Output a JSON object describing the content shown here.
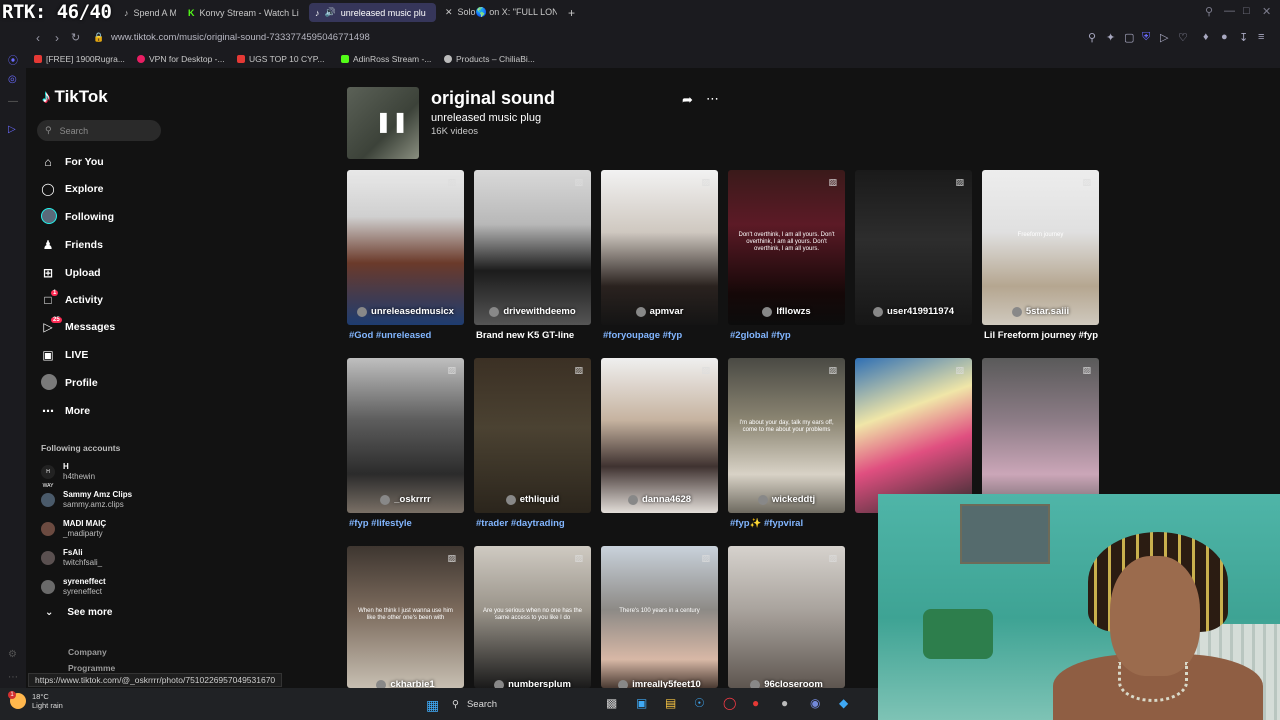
{
  "overlay": {
    "rtk": "RTK: 46/40"
  },
  "tabs": [
    {
      "label": "Spend A M",
      "active": false,
      "icon": "tiktok-icon"
    },
    {
      "label": "Konvy Stream - Watch Li",
      "active": false,
      "icon": "kick-icon"
    },
    {
      "label": "unreleased music plu",
      "active": true,
      "icon": "tiktok-icon"
    },
    {
      "label": "Solo🌎 on X: \"FULL LON",
      "active": false,
      "icon": "x-icon"
    }
  ],
  "address": {
    "url": "www.tiktok.com/music/original-sound-7333774595046771498"
  },
  "bookmarks": [
    {
      "label": "[FREE] 1900Rugra...",
      "color": "#e53935"
    },
    {
      "label": "VPN for Desktop -...",
      "color": "#e91e63"
    },
    {
      "label": "UGS TOP 10 CYP...",
      "color": "#e53935"
    },
    {
      "label": "AdinRoss Stream -...",
      "color": "#53fc18"
    },
    {
      "label": "Products – ChiliaBi...",
      "color": "#bbbbbb"
    }
  ],
  "brand": {
    "name": "TikTok"
  },
  "search": {
    "placeholder": "Search"
  },
  "nav": [
    {
      "label": "For You",
      "icon": "home-icon"
    },
    {
      "label": "Explore",
      "icon": "compass-icon"
    },
    {
      "label": "Following",
      "icon": "following-avatar"
    },
    {
      "label": "Friends",
      "icon": "friends-icon"
    },
    {
      "label": "Upload",
      "icon": "upload-icon"
    },
    {
      "label": "Activity",
      "icon": "activity-icon",
      "badge": "1"
    },
    {
      "label": "Messages",
      "icon": "messages-icon",
      "badge": "25"
    },
    {
      "label": "LIVE",
      "icon": "live-icon"
    },
    {
      "label": "Profile",
      "icon": "profile-avatar"
    },
    {
      "label": "More",
      "icon": "more-icon"
    }
  ],
  "following_accounts": {
    "title": "Following accounts",
    "items": [
      {
        "display": "H",
        "handle": "h4thewin"
      },
      {
        "display": "Sammy Amz Clips",
        "handle": "sammy.amz.clips"
      },
      {
        "display": "MADI MAIÇ",
        "handle": "_madiparty"
      },
      {
        "display": "FsAli",
        "handle": "twitchfsali_"
      },
      {
        "display": "syreneffect",
        "handle": "syreneffect"
      }
    ],
    "see_more": "See more"
  },
  "footer_links": {
    "company": "Company",
    "program": "Programme"
  },
  "sound": {
    "title": "original sound",
    "subtitle": "unreleased music plug",
    "video_count": "16K videos"
  },
  "videos": [
    {
      "user": "unreleasedmusicx",
      "caption": "#God #unreleased",
      "caption_type": "hash",
      "bg": "linear-gradient(180deg,#e8e8e8 0%,#d0d0d0 30%,#6b3a2a 60%,#1e3c70 100%)",
      "overlay": ""
    },
    {
      "user": "drivewithdeemo",
      "caption": "Brand new K5 GT-line",
      "caption_type": "plain",
      "bg": "linear-gradient(180deg,#d9d9d9 0%,#b8b8b8 35%,#1c1c1c 65%,#555 100%)",
      "overlay": ""
    },
    {
      "user": "apmvar",
      "caption": "#foryoupage #fyp",
      "caption_type": "hash",
      "bg": "linear-gradient(180deg,#f2f2f2 0%,#cfc8c0 40%,#2a221f 75%,#141414 100%)",
      "overlay": ""
    },
    {
      "user": "lfllowzs",
      "caption": "#2global #fyp",
      "caption_type": "hash",
      "bg": "linear-gradient(180deg,#3a1a1a 0%,#5c1a26 35%,#150808 80%,#0c0c0c 100%)",
      "overlay": "Don't overthink, I am all yours.\nDon't overthink, I am all yours.\nDon't overthink, I am all yours."
    },
    {
      "user": "user419911974",
      "caption": "",
      "caption_type": "plain",
      "bg": "linear-gradient(180deg,#1a1a1a 0%,#2d2d2d 45%,#161616 100%)",
      "overlay": ""
    },
    {
      "user": "5star.saiii",
      "caption": "Lil Freeform journey #fyp",
      "caption_type": "plain",
      "bg": "linear-gradient(180deg,#ededed 0%,#e0e0e0 40%,#b5a690 75%,#cfc9be 100%)",
      "overlay": "Freeform journey"
    },
    {
      "user": "_oskrrrr",
      "caption": "#fyp #lifestyle",
      "caption_type": "hash",
      "bg": "linear-gradient(180deg,#bfbfbf 0%,#5d5d5d 40%,#2b2b2b 75%,#7a7066 100%)",
      "overlay": ""
    },
    {
      "user": "ethliquid",
      "caption": "#trader #daytrading",
      "caption_type": "hash",
      "bg": "linear-gradient(180deg,#3b3024 0%,#4b4232 45%,#2b251c 100%)",
      "overlay": ""
    },
    {
      "user": "danna4628",
      "caption": "",
      "caption_type": "plain",
      "bg": "linear-gradient(180deg,#efefef 0%,#c6b3a0 40%,#3f3230 70%,#e3ded9 100%)",
      "overlay": ""
    },
    {
      "user": "wickeddtj",
      "caption": "#fyp✨ #fypviral",
      "caption_type": "hash",
      "bg": "linear-gradient(180deg,#4a4a44 0%,#8b8572 40%,#d8d2c6 75%,#6e6a60 100%)",
      "overlay": "I'm about your day, talk my ears off, come to me about your problems"
    },
    {
      "user": "",
      "caption": "",
      "caption_type": "plain",
      "bg": "linear-gradient(160deg,#2f6fb4 0%,#f0e6a8 35%,#e04f80 60%,#2a2a2a 100%)",
      "overlay": ""
    },
    {
      "user": "",
      "caption": "",
      "caption_type": "plain",
      "bg": "linear-gradient(180deg,#5a5a5a 0%,#8c7c86 40%,#cba6b8 75%,#6a6266 100%)",
      "overlay": ""
    },
    {
      "user": "ckharbie1",
      "caption": "",
      "caption_type": "plain",
      "bg": "linear-gradient(180deg,#3e3630 0%,#7b6a5c 45%,#c7bfb2 100%)",
      "overlay": "When he think I just wanna use him like the other one's been with"
    },
    {
      "user": "numbersplum",
      "caption": "",
      "caption_type": "plain",
      "bg": "linear-gradient(180deg,#cfcac2 0%,#9a948a 45%,#1a1a1a 100%)",
      "overlay": "Are you serious when no one has the same access to you like I do"
    },
    {
      "user": "imreally5feet10",
      "caption": "",
      "caption_type": "plain",
      "bg": "linear-gradient(180deg,#c9d2db 0%,#8d8a86 45%,#d8b8a6 80%,#4a3a32 100%)",
      "overlay": "There's 100 years in a century"
    },
    {
      "user": "96closeroom",
      "caption": "",
      "caption_type": "plain",
      "bg": "linear-gradient(180deg,#d6d2cd 0%,#a9a39d 45%,#5e5650 100%)",
      "overlay": ""
    }
  ],
  "status_url": "https://www.tiktok.com/@_oskrrrr/photo/7510226957049531670",
  "taskbar": {
    "temp": "18°C",
    "condition": "Light rain",
    "search": "Search",
    "weather_badge": "1"
  }
}
